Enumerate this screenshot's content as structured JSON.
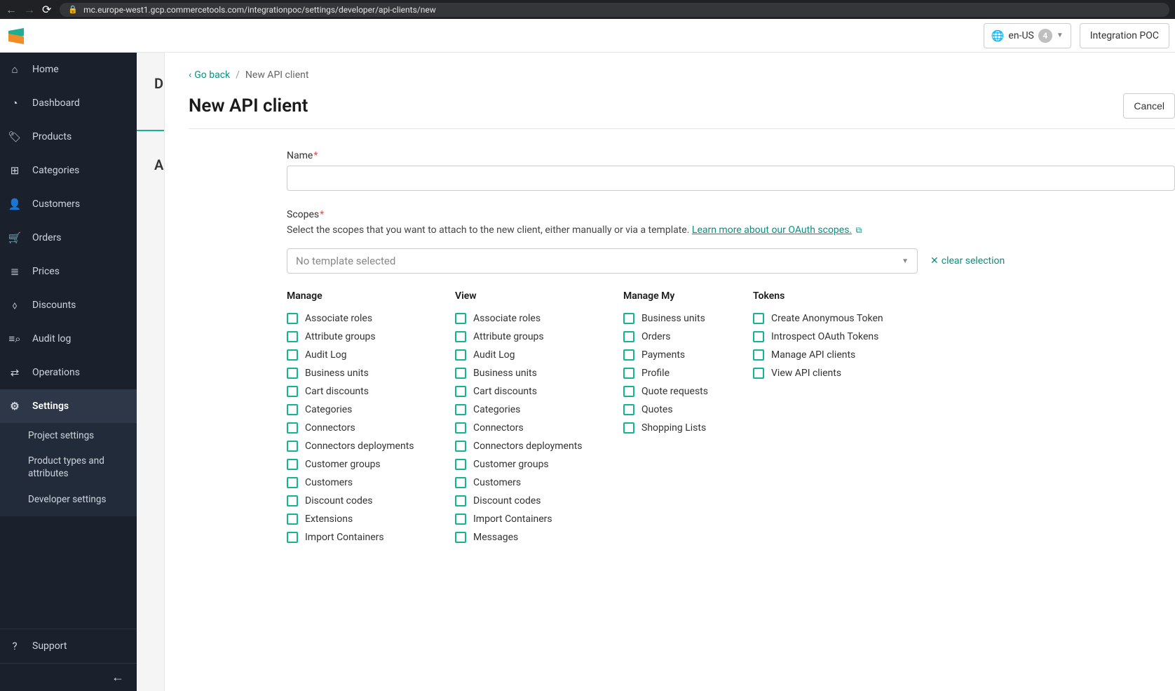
{
  "browser": {
    "url": "mc.europe-west1.gcp.commercetools.com/integrationpoc/settings/developer/api-clients/new"
  },
  "header": {
    "locale": "en-US",
    "notification_count": "4",
    "project_name": "Integration POC"
  },
  "sidebar": {
    "items": [
      {
        "label": "Home",
        "icon": "home"
      },
      {
        "label": "Dashboard",
        "icon": "gauge"
      },
      {
        "label": "Products",
        "icon": "tag"
      },
      {
        "label": "Categories",
        "icon": "grid"
      },
      {
        "label": "Customers",
        "icon": "user"
      },
      {
        "label": "Orders",
        "icon": "cart"
      },
      {
        "label": "Prices",
        "icon": "stack"
      },
      {
        "label": "Discounts",
        "icon": "percent"
      },
      {
        "label": "Audit log",
        "icon": "search-list"
      },
      {
        "label": "Operations",
        "icon": "cycle"
      },
      {
        "label": "Settings",
        "icon": "gear"
      }
    ],
    "settings_sub": [
      "Project settings",
      "Product types and attributes",
      "Developer settings"
    ],
    "support": "Support"
  },
  "breadcrumb": {
    "go_back": "Go back",
    "current": "New API client"
  },
  "page": {
    "title": "New API client",
    "cancel": "Cancel"
  },
  "form": {
    "name_label": "Name",
    "scopes_label": "Scopes",
    "scopes_help": "Select the scopes that you want to attach to the new client, either manually or via a template.",
    "scopes_link": "Learn more about our OAuth scopes.",
    "template_placeholder": "No template selected",
    "clear_selection": "clear selection"
  },
  "scopes": {
    "columns": {
      "manage": "Manage",
      "view": "View",
      "manage_my": "Manage My",
      "tokens": "Tokens"
    },
    "manage": [
      "Associate roles",
      "Attribute groups",
      "Audit Log",
      "Business units",
      "Cart discounts",
      "Categories",
      "Connectors",
      "Connectors deployments",
      "Customer groups",
      "Customers",
      "Discount codes",
      "Extensions",
      "Import Containers"
    ],
    "view": [
      "Associate roles",
      "Attribute groups",
      "Audit Log",
      "Business units",
      "Cart discounts",
      "Categories",
      "Connectors",
      "Connectors deployments",
      "Customer groups",
      "Customers",
      "Discount codes",
      "Import Containers",
      "Messages"
    ],
    "manage_my": [
      "Business units",
      "Orders",
      "Payments",
      "Profile",
      "Quote requests",
      "Quotes",
      "Shopping Lists"
    ],
    "tokens": [
      "Create Anonymous Token",
      "Introspect OAuth Tokens",
      "Manage API clients",
      "View API clients"
    ]
  }
}
